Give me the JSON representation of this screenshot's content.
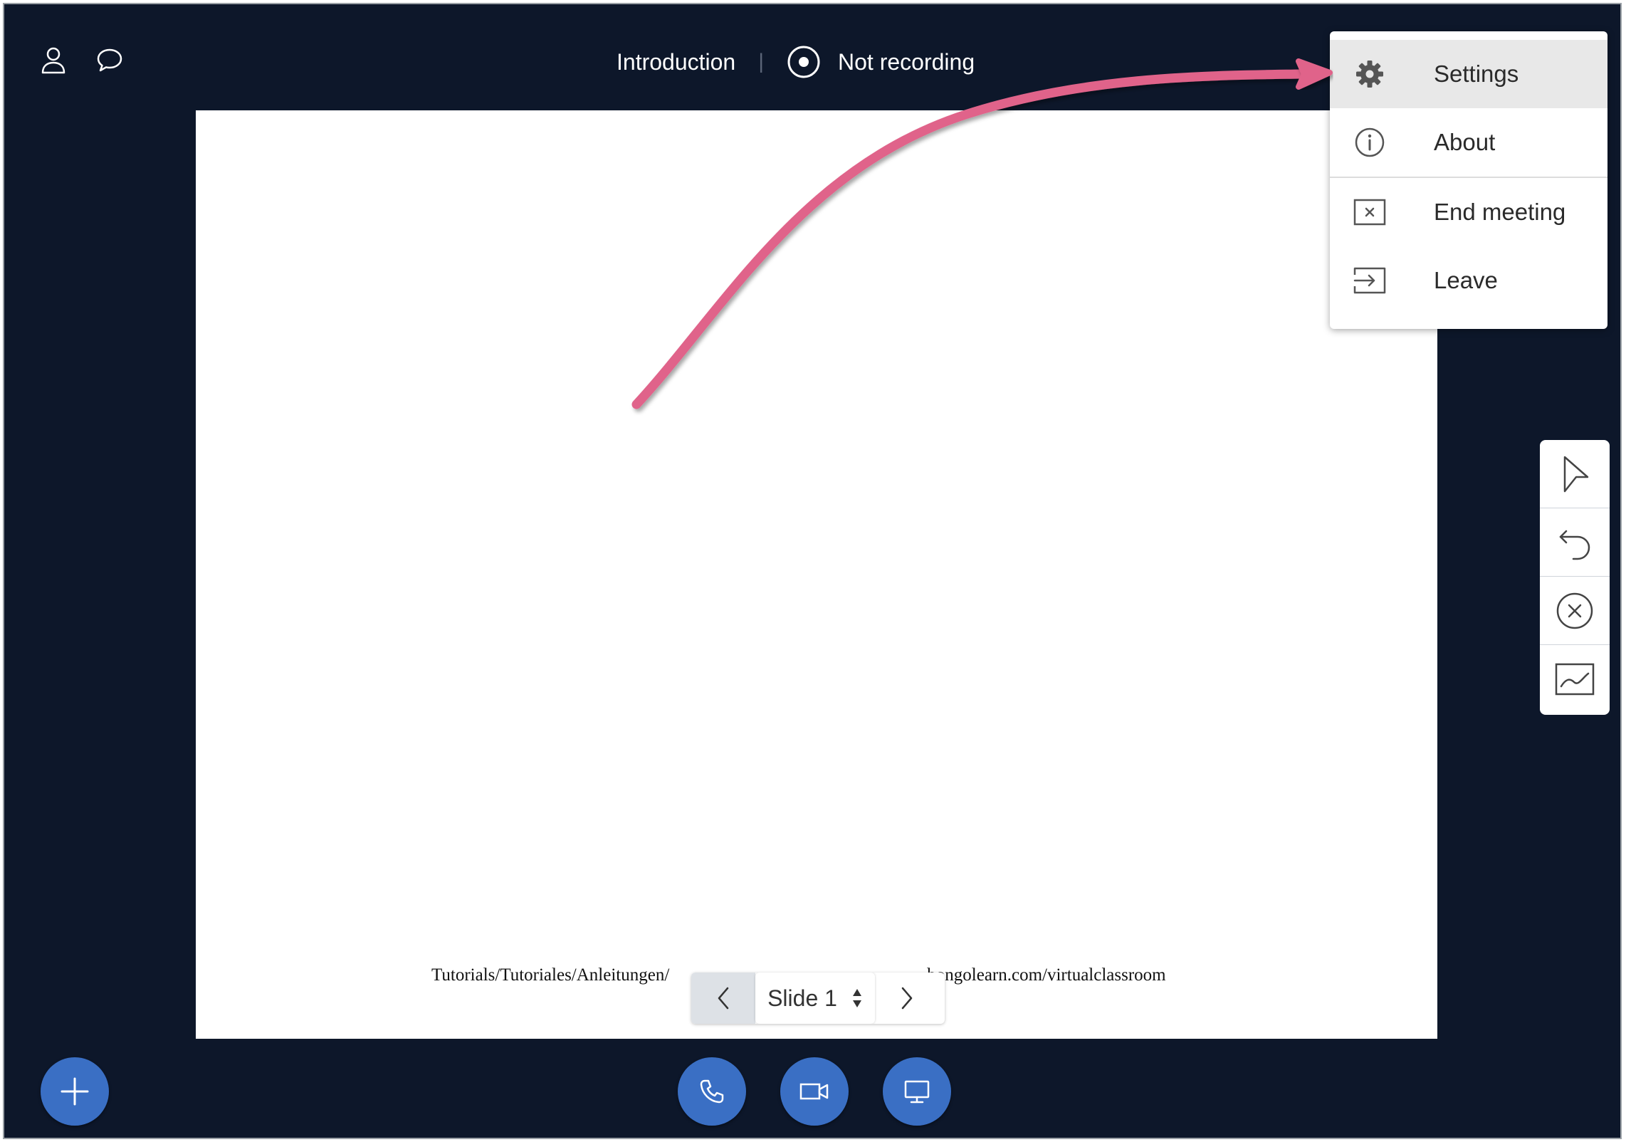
{
  "header": {
    "presentation_title": "Introduction",
    "separator": "|",
    "recording_status": "Not recording"
  },
  "icons": {
    "users": "user-icon",
    "chat": "chat-bubble-icon",
    "record": "record-icon"
  },
  "slide": {
    "footer_text": "Tutorials/Tutoriales/Anleitungen/",
    "footer_text_right": "bongolearn.com/virtualclassroom",
    "current_slide": "Slide 1"
  },
  "menu": {
    "items": [
      {
        "label": "Settings",
        "icon": "gear-icon",
        "active": true
      },
      {
        "label": "About",
        "icon": "info-icon",
        "active": false
      },
      {
        "label": "End meeting",
        "icon": "end-meeting-icon",
        "active": false
      },
      {
        "label": "Leave",
        "icon": "leave-icon",
        "active": false
      }
    ]
  },
  "toolbar": {
    "tools": [
      "pointer-icon",
      "undo-icon",
      "clear-icon",
      "whiteboard-icon"
    ]
  },
  "bottom_actions": {
    "actions": [
      "plus-icon",
      "phone-icon",
      "video-camera-icon",
      "screen-share-icon"
    ]
  },
  "colors": {
    "background": "#0d172a",
    "action_blue": "#3a6fc4",
    "annotation_pink": "#e0648a",
    "menu_active": "#e8e8e8"
  }
}
